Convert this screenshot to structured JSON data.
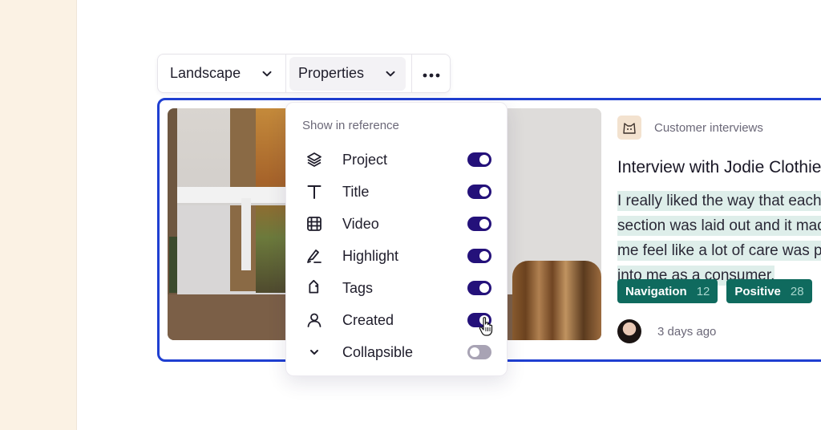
{
  "toolbar": {
    "layout_label": "Landscape",
    "properties_label": "Properties",
    "more_icon": "ellipsis-icon"
  },
  "dropdown": {
    "heading": "Show in reference",
    "items": [
      {
        "label": "Project",
        "icon": "layers-icon",
        "enabled": true
      },
      {
        "label": "Title",
        "icon": "text-t-icon",
        "enabled": true
      },
      {
        "label": "Video",
        "icon": "film-icon",
        "enabled": true
      },
      {
        "label": "Highlight",
        "icon": "highlighter-icon",
        "enabled": true
      },
      {
        "label": "Tags",
        "icon": "tag-icon",
        "enabled": true
      },
      {
        "label": "Created",
        "icon": "user-icon",
        "enabled": true
      },
      {
        "label": "Collapsible",
        "icon": "chevron-down-icon",
        "enabled": false
      }
    ]
  },
  "reference": {
    "project": "Customer interviews",
    "title": "Interview with Jodie Clothier",
    "quote": "I really liked the way that each section was laid out and it made me feel like a lot of care was put into me as a consumer.",
    "tags": [
      {
        "label": "Navigation",
        "count": "12"
      },
      {
        "label": "Positive",
        "count": "28"
      }
    ],
    "created": "3 days ago"
  },
  "colors": {
    "accent_blue": "#1f3fd1",
    "toggle_on": "#24117a",
    "toggle_off": "#a8a3b4",
    "tag_bg": "#0f6a5e",
    "highlight_bg": "#deeeea",
    "sidebar_bg": "#fbf2e4"
  }
}
